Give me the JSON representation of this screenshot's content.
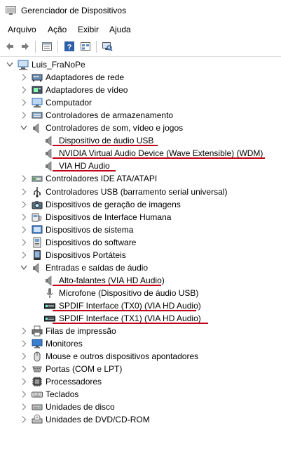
{
  "window": {
    "title": "Gerenciador de Dispositivos"
  },
  "menu": [
    "Arquivo",
    "Ação",
    "Exibir",
    "Ajuda"
  ],
  "toolbar": [
    "back-icon",
    "forward-icon",
    "properties-icon",
    "help-icon",
    "view-icon",
    "scan-hardware-icon"
  ],
  "tree": {
    "root": "Luis_FraNoPe",
    "items": [
      {
        "label": "Adaptadores de rede",
        "expanded": false,
        "icon": "network-adapter-icon"
      },
      {
        "label": "Adaptadores de vídeo",
        "expanded": false,
        "icon": "display-adapter-icon"
      },
      {
        "label": "Computador",
        "expanded": false,
        "icon": "computer-icon"
      },
      {
        "label": "Controladores de armazenamento",
        "expanded": false,
        "icon": "storage-controller-icon"
      },
      {
        "label": "Controladores de som, vídeo e jogos",
        "expanded": true,
        "icon": "speaker-icon",
        "children": [
          {
            "label": "Dispositivo de áudio USB",
            "icon": "speaker-icon",
            "highlighted": true
          },
          {
            "label": "NVIDIA Virtual Audio Device (Wave Extensible) (WDM)",
            "icon": "speaker-icon",
            "highlighted": true
          },
          {
            "label": "VIA HD Audio",
            "icon": "speaker-icon",
            "highlighted": true
          }
        ]
      },
      {
        "label": "Controladores IDE ATA/ATAPI",
        "expanded": false,
        "icon": "ide-controller-icon"
      },
      {
        "label": "Controladores USB (barramento serial universal)",
        "expanded": false,
        "icon": "usb-icon"
      },
      {
        "label": "Dispositivos de geração de imagens",
        "expanded": false,
        "icon": "camera-icon"
      },
      {
        "label": "Dispositivos de Interface Humana",
        "expanded": false,
        "icon": "hid-icon"
      },
      {
        "label": "Dispositivos de sistema",
        "expanded": false,
        "icon": "system-device-icon"
      },
      {
        "label": "Dispositivos do software",
        "expanded": false,
        "icon": "software-device-icon"
      },
      {
        "label": "Dispositivos Portáteis",
        "expanded": false,
        "icon": "portable-device-icon"
      },
      {
        "label": "Entradas e saídas de áudio",
        "expanded": true,
        "icon": "speaker-icon",
        "children": [
          {
            "label": "Alto-falantes (VIA HD Audio)",
            "icon": "speaker-icon",
            "highlighted": true
          },
          {
            "label": "Microfone (Dispositivo de áudio USB)",
            "icon": "microphone-icon",
            "highlighted": false
          },
          {
            "label": "SPDIF Interface (TX0) (VIA HD Audio)",
            "icon": "spdif-icon",
            "highlighted": true
          },
          {
            "label": "SPDIF Interface (TX1) (VIA HD Audio)",
            "icon": "spdif-icon",
            "highlighted": true
          }
        ]
      },
      {
        "label": "Filas de impressão",
        "expanded": false,
        "icon": "printer-icon"
      },
      {
        "label": "Monitores",
        "expanded": false,
        "icon": "monitor-icon"
      },
      {
        "label": "Mouse e outros dispositivos apontadores",
        "expanded": false,
        "icon": "mouse-icon"
      },
      {
        "label": "Portas (COM e LPT)",
        "expanded": false,
        "icon": "port-icon"
      },
      {
        "label": "Processadores",
        "expanded": false,
        "icon": "processor-icon"
      },
      {
        "label": "Teclados",
        "expanded": false,
        "icon": "keyboard-icon"
      },
      {
        "label": "Unidades de disco",
        "expanded": false,
        "icon": "disk-drive-icon"
      },
      {
        "label": "Unidades de DVD/CD-ROM",
        "expanded": false,
        "icon": "dvd-drive-icon"
      }
    ]
  },
  "colors": {
    "highlight_underline": "#c00018",
    "tree_icon_blue": "#2f6fb7"
  }
}
